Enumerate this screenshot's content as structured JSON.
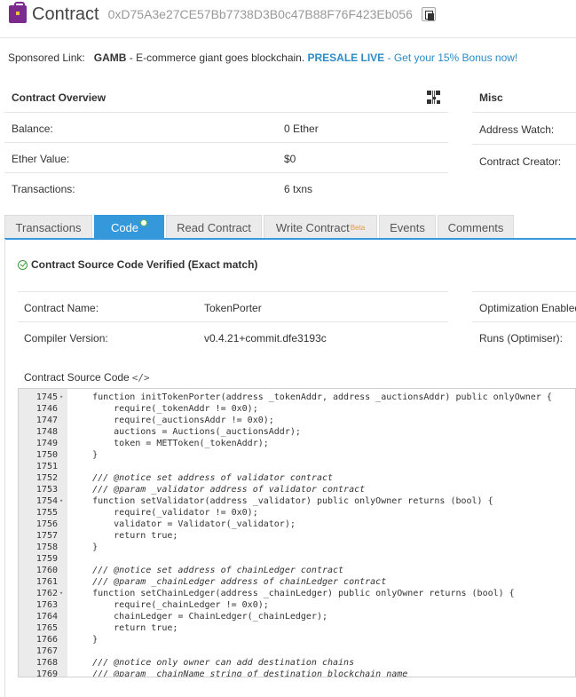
{
  "header": {
    "title": "Contract",
    "address": "0xD75A3e27CE57Bb7738D3B0c47B88F76F423Eb056"
  },
  "sponsor": {
    "label": "Sponsored Link:",
    "brand": "GAMB",
    "description": " - E-commerce giant goes blockchain. ",
    "presale": "PRESALE LIVE",
    "bonus": " - Get your 15% Bonus now!"
  },
  "overview": {
    "title": "Contract Overview",
    "rows": [
      {
        "label": "Balance:",
        "value": "0 Ether"
      },
      {
        "label": "Ether Value:",
        "value": "$0"
      },
      {
        "label": "Transactions:",
        "value": "6 txns"
      }
    ]
  },
  "misc": {
    "title": "Misc",
    "rows": [
      {
        "label": "Address Watch:"
      },
      {
        "label": "Contract Creator:"
      }
    ]
  },
  "tabs": [
    {
      "label": "Transactions"
    },
    {
      "label": "Code"
    },
    {
      "label": "Read Contract"
    },
    {
      "label": "Write Contract",
      "sup": "Beta"
    },
    {
      "label": "Events"
    },
    {
      "label": "Comments"
    }
  ],
  "code_tab": {
    "verified": "Contract Source Code Verified (Exact match)",
    "contract_name_label": "Contract Name:",
    "contract_name": "TokenPorter",
    "compiler_label": "Compiler Version:",
    "compiler": "v0.4.21+commit.dfe3193c",
    "optimization_label": "Optimization Enabled:",
    "runs_label": "Runs (Optimiser):",
    "source_label": "Contract Source Code",
    "source_icon": "</>"
  },
  "code": {
    "lines": [
      {
        "n": "1745",
        "fold": true,
        "text": "    function initTokenPorter(address _tokenAddr, address _auctionsAddr) public onlyOwner {"
      },
      {
        "n": "1746",
        "fold": false,
        "text": "        require(_tokenAddr != 0x0);"
      },
      {
        "n": "1747",
        "fold": false,
        "text": "        require(_auctionsAddr != 0x0);"
      },
      {
        "n": "1748",
        "fold": false,
        "text": "        auctions = Auctions(_auctionsAddr);"
      },
      {
        "n": "1749",
        "fold": false,
        "text": "        token = METToken(_tokenAddr);"
      },
      {
        "n": "1750",
        "fold": false,
        "text": "    }"
      },
      {
        "n": "1751",
        "fold": false,
        "text": ""
      },
      {
        "n": "1752",
        "fold": false,
        "text": "    /// @notice set address of validator contract"
      },
      {
        "n": "1753",
        "fold": false,
        "text": "    /// @param _validator address of validator contract"
      },
      {
        "n": "1754",
        "fold": true,
        "text": "    function setValidator(address _validator) public onlyOwner returns (bool) {"
      },
      {
        "n": "1755",
        "fold": false,
        "text": "        require(_validator != 0x0);"
      },
      {
        "n": "1756",
        "fold": false,
        "text": "        validator = Validator(_validator);"
      },
      {
        "n": "1757",
        "fold": false,
        "text": "        return true;"
      },
      {
        "n": "1758",
        "fold": false,
        "text": "    }"
      },
      {
        "n": "1759",
        "fold": false,
        "text": ""
      },
      {
        "n": "1760",
        "fold": false,
        "text": "    /// @notice set address of chainLedger contract"
      },
      {
        "n": "1761",
        "fold": false,
        "text": "    /// @param _chainLedger address of chainLedger contract"
      },
      {
        "n": "1762",
        "fold": true,
        "text": "    function setChainLedger(address _chainLedger) public onlyOwner returns (bool) {"
      },
      {
        "n": "1763",
        "fold": false,
        "text": "        require(_chainLedger != 0x0);"
      },
      {
        "n": "1764",
        "fold": false,
        "text": "        chainLedger = ChainLedger(_chainLedger);"
      },
      {
        "n": "1765",
        "fold": false,
        "text": "        return true;"
      },
      {
        "n": "1766",
        "fold": false,
        "text": "    }"
      },
      {
        "n": "1767",
        "fold": false,
        "text": ""
      },
      {
        "n": "1768",
        "fold": false,
        "text": "    /// @notice only owner can add destination chains"
      },
      {
        "n": "1769",
        "fold": false,
        "text": "    /// @param _chainName string of destination blockchain name"
      }
    ]
  }
}
